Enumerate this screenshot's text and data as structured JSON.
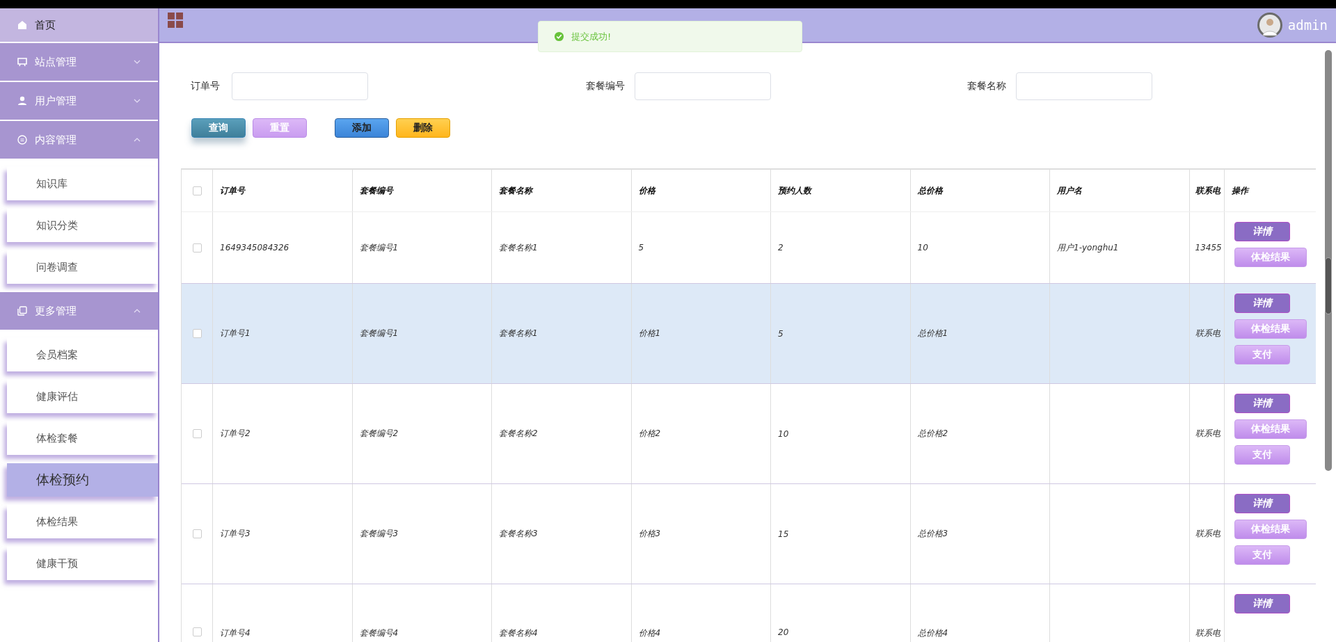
{
  "sidebar": {
    "home": {
      "label": "首页"
    },
    "groups": [
      {
        "label": "站点管理",
        "expanded": false
      },
      {
        "label": "用户管理",
        "expanded": false
      },
      {
        "label": "内容管理",
        "expanded": true,
        "items": [
          {
            "label": "知识库",
            "selected": false
          },
          {
            "label": "知识分类",
            "selected": false
          },
          {
            "label": "问卷调查",
            "selected": false
          }
        ]
      },
      {
        "label": "更多管理",
        "expanded": true,
        "items": [
          {
            "label": "会员档案",
            "selected": false
          },
          {
            "label": "健康评估",
            "selected": false
          },
          {
            "label": "体检套餐",
            "selected": false
          },
          {
            "label": "体检预约",
            "selected": true
          },
          {
            "label": "体检结果",
            "selected": false
          },
          {
            "label": "健康干预",
            "selected": false
          }
        ]
      }
    ]
  },
  "header": {
    "user": "admin"
  },
  "toast": {
    "kind": "success",
    "message": "提交成功!"
  },
  "search": {
    "fields": [
      {
        "label": "订单号"
      },
      {
        "label": "套餐编号"
      },
      {
        "label": "套餐名称"
      }
    ],
    "buttons": [
      {
        "label": "查询",
        "kind": "query"
      },
      {
        "label": "重置",
        "kind": "reset"
      },
      {
        "label": "添加",
        "kind": "add"
      },
      {
        "label": "删除",
        "kind": "delete"
      }
    ]
  },
  "table": {
    "header_checked": false,
    "columns": [
      "订单号",
      "套餐编号",
      "套餐名称",
      "价格",
      "预约人数",
      "总价格",
      "用户名",
      "联系电",
      "操作"
    ],
    "rows": [
      {
        "checked": false,
        "highlighted": false,
        "cells": [
          "1649345084326",
          "套餐编号1",
          "套餐名称1",
          "5",
          "2",
          "10",
          "用户1-yonghu1",
          "13455"
        ],
        "actions": [
          {
            "label": "详情",
            "kind": "detail"
          },
          {
            "label": "体检结果",
            "kind": "result"
          }
        ]
      },
      {
        "checked": false,
        "highlighted": true,
        "cells": [
          "订单号1",
          "套餐编号1",
          "套餐名称1",
          "价格1",
          "5",
          "总价格1",
          "",
          "联系电"
        ],
        "actions": [
          {
            "label": "详情",
            "kind": "detail"
          },
          {
            "label": "体检结果",
            "kind": "result"
          },
          {
            "label": "支付",
            "kind": "pay"
          }
        ]
      },
      {
        "checked": false,
        "highlighted": false,
        "cells": [
          "订单号2",
          "套餐编号2",
          "套餐名称2",
          "价格2",
          "10",
          "总价格2",
          "",
          "联系电"
        ],
        "actions": [
          {
            "label": "详情",
            "kind": "detail"
          },
          {
            "label": "体检结果",
            "kind": "result"
          },
          {
            "label": "支付",
            "kind": "pay"
          }
        ]
      },
      {
        "checked": false,
        "highlighted": false,
        "cells": [
          "订单号3",
          "套餐编号3",
          "套餐名称3",
          "价格3",
          "15",
          "总价格3",
          "",
          "联系电"
        ],
        "actions": [
          {
            "label": "详情",
            "kind": "detail"
          },
          {
            "label": "体检结果",
            "kind": "result"
          },
          {
            "label": "支付",
            "kind": "pay"
          }
        ]
      },
      {
        "checked": false,
        "highlighted": false,
        "cells": [
          "订单号4",
          "套餐编号4",
          "套餐名称4",
          "价格4",
          "20",
          "总价格4",
          "",
          "联系电"
        ],
        "actions": [
          {
            "label": "详情",
            "kind": "detail"
          }
        ]
      }
    ]
  }
}
